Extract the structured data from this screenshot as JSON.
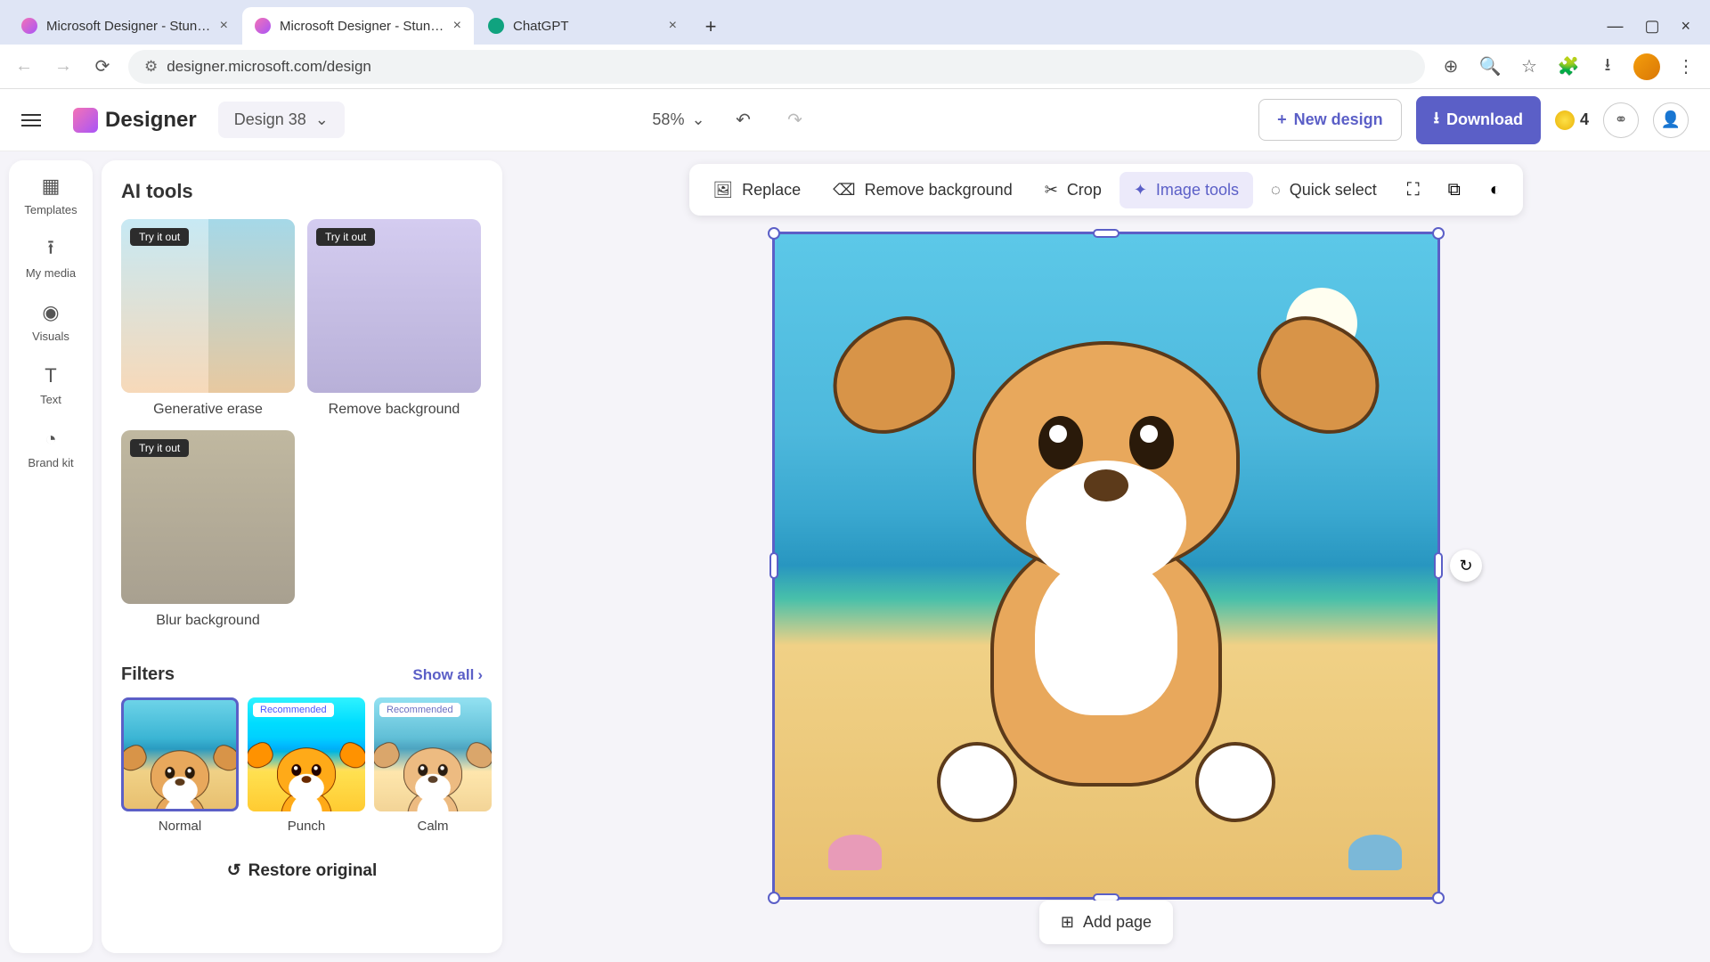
{
  "browser": {
    "tabs": [
      {
        "title": "Microsoft Designer - Stunning",
        "active": false
      },
      {
        "title": "Microsoft Designer - Stunning",
        "active": true
      },
      {
        "title": "ChatGPT",
        "active": false
      }
    ],
    "url": "designer.microsoft.com/design"
  },
  "header": {
    "app_name": "Designer",
    "design_name": "Design 38",
    "zoom": "58%",
    "new_design": "New design",
    "download": "Download",
    "credits": "4"
  },
  "left_rail": {
    "items": [
      "Templates",
      "My media",
      "Visuals",
      "Text",
      "Brand kit"
    ]
  },
  "side_panel": {
    "ai_tools_title": "AI tools",
    "try_badge": "Try it out",
    "ai_cards": [
      {
        "label": "Generative erase"
      },
      {
        "label": "Remove background"
      },
      {
        "label": "Blur background"
      }
    ],
    "filters_title": "Filters",
    "show_all": "Show all",
    "recommended": "Recommended",
    "filters": [
      {
        "label": "Normal",
        "selected": true
      },
      {
        "label": "Punch",
        "recommended": true
      },
      {
        "label": "Calm",
        "recommended": true
      }
    ],
    "restore": "Restore original"
  },
  "context_toolbar": {
    "replace": "Replace",
    "remove_bg": "Remove background",
    "crop": "Crop",
    "image_tools": "Image tools",
    "quick_select": "Quick select"
  },
  "canvas": {
    "add_page": "Add page"
  }
}
